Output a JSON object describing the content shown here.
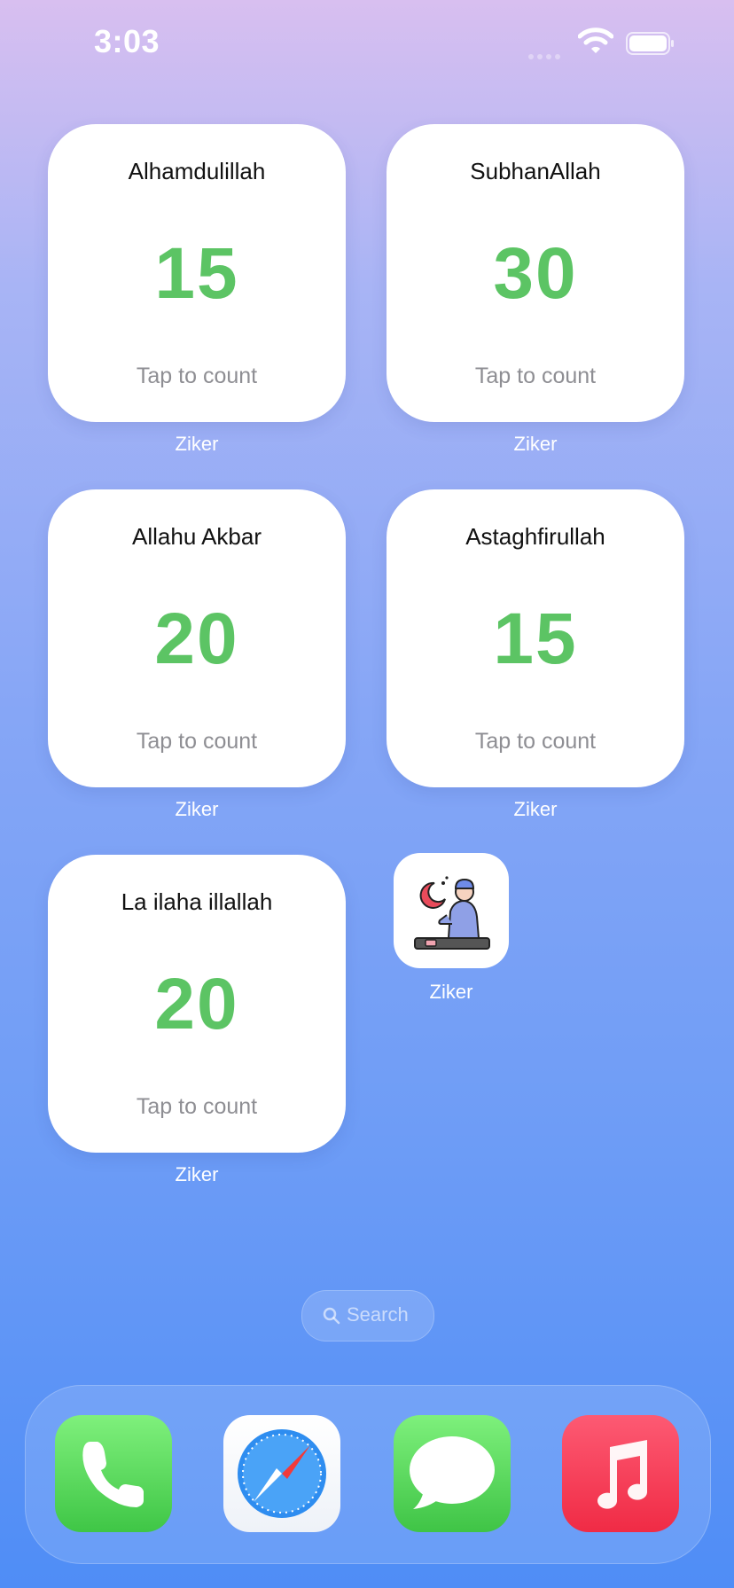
{
  "status_bar": {
    "time": "3:03",
    "icons": [
      "cellular-signal-icon",
      "wifi-icon",
      "battery-icon"
    ]
  },
  "widgets": [
    {
      "title": "Alhamdulillah",
      "count": "15",
      "hint": "Tap to count",
      "label": "Ziker"
    },
    {
      "title": "SubhanAllah",
      "count": "30",
      "hint": "Tap to count",
      "label": "Ziker"
    },
    {
      "title": "Allahu Akbar",
      "count": "20",
      "hint": "Tap to count",
      "label": "Ziker"
    },
    {
      "title": "Astaghfirullah",
      "count": "15",
      "hint": "Tap to count",
      "label": "Ziker"
    },
    {
      "title": "La ilaha illallah",
      "count": "20",
      "hint": "Tap to count",
      "label": "Ziker"
    }
  ],
  "app": {
    "label": "Ziker",
    "icon": "praying-man-icon"
  },
  "search": {
    "label": "Search",
    "icon": "search-icon"
  },
  "dock": {
    "apps": [
      {
        "name": "Phone",
        "icon": "phone-icon"
      },
      {
        "name": "Safari",
        "icon": "safari-compass-icon"
      },
      {
        "name": "Messages",
        "icon": "messages-bubble-icon"
      },
      {
        "name": "Music",
        "icon": "music-note-icon"
      }
    ]
  },
  "colors": {
    "count_green": "#5cc464",
    "background_top": "#d8bff0",
    "background_bottom": "#4f8df6"
  }
}
